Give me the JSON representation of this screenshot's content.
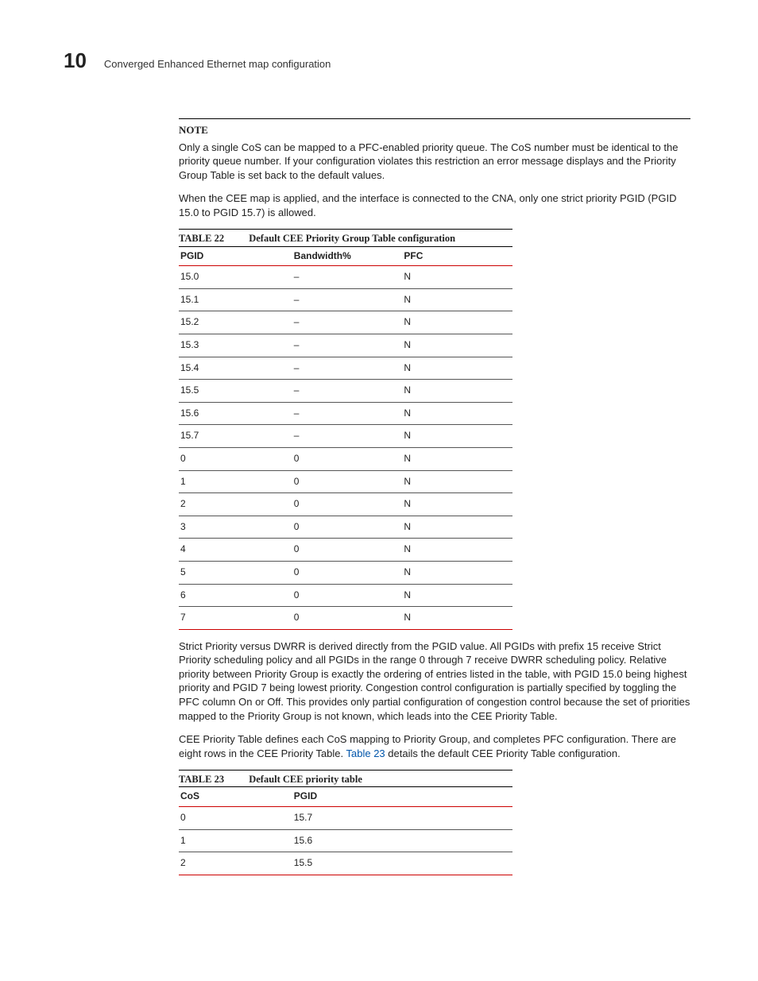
{
  "header": {
    "chapter_number": "10",
    "section_title": "Converged Enhanced Ethernet map configuration"
  },
  "note": {
    "label": "NOTE",
    "text": "Only a single CoS can be mapped to a PFC-enabled priority queue. The CoS number must be identical to the priority queue number. If your configuration violates this restriction an error message displays and the Priority Group Table is set back to the default values."
  },
  "para1": "When the CEE map is applied, and the interface is connected to the CNA, only one strict priority PGID (PGID 15.0 to PGID 15.7) is allowed.",
  "table22": {
    "label": "TABLE 22",
    "title": "Default CEE Priority Group Table configuration",
    "headers": {
      "c1": "PGID",
      "c2": "Bandwidth%",
      "c3": "PFC"
    },
    "rows": [
      {
        "c1": "15.0",
        "c2": "–",
        "c3": "N"
      },
      {
        "c1": "15.1",
        "c2": "–",
        "c3": "N"
      },
      {
        "c1": "15.2",
        "c2": "–",
        "c3": "N"
      },
      {
        "c1": "15.3",
        "c2": "–",
        "c3": "N"
      },
      {
        "c1": "15.4",
        "c2": "–",
        "c3": "N"
      },
      {
        "c1": "15.5",
        "c2": "–",
        "c3": "N"
      },
      {
        "c1": "15.6",
        "c2": "–",
        "c3": "N"
      },
      {
        "c1": "15.7",
        "c2": "–",
        "c3": "N"
      },
      {
        "c1": "0",
        "c2": "0",
        "c3": "N"
      },
      {
        "c1": "1",
        "c2": "0",
        "c3": "N"
      },
      {
        "c1": "2",
        "c2": "0",
        "c3": "N"
      },
      {
        "c1": "3",
        "c2": "0",
        "c3": "N"
      },
      {
        "c1": "4",
        "c2": "0",
        "c3": "N"
      },
      {
        "c1": "5",
        "c2": "0",
        "c3": "N"
      },
      {
        "c1": "6",
        "c2": "0",
        "c3": "N"
      },
      {
        "c1": "7",
        "c2": "0",
        "c3": "N"
      }
    ]
  },
  "para2": "Strict Priority versus DWRR is derived directly from the PGID value. All PGIDs with prefix 15 receive Strict Priority scheduling policy and all PGIDs in the range 0 through 7 receive DWRR scheduling policy. Relative priority between Priority Group is exactly the ordering of entries listed in the table, with PGID 15.0 being highest priority and PGID 7 being lowest priority. Congestion control configuration is partially specified by toggling the PFC column On or Off. This provides only partial configuration of congestion control because the set of priorities mapped to the Priority Group is not known, which leads into the CEE Priority Table.",
  "para3a": "CEE Priority Table defines each CoS mapping to Priority Group, and completes PFC configuration. There are eight rows in the CEE Priority Table. ",
  "para3_link": "Table 23",
  "para3b": " details the default CEE Priority Table configuration.",
  "table23": {
    "label": "TABLE 23",
    "title": "Default CEE priority table",
    "headers": {
      "c1": "CoS",
      "c2": "PGID"
    },
    "rows": [
      {
        "c1": "0",
        "c2": "15.7"
      },
      {
        "c1": "1",
        "c2": "15.6"
      },
      {
        "c1": "2",
        "c2": "15.5"
      }
    ]
  }
}
